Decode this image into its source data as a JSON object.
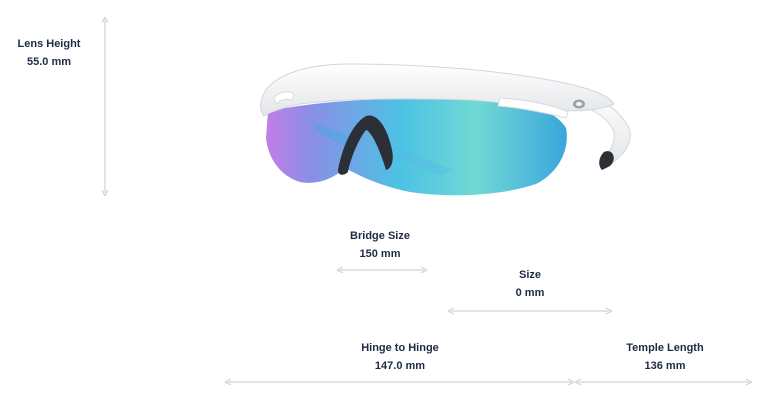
{
  "measurements": {
    "lens_height": {
      "label": "Lens Height",
      "value": "55.0 mm"
    },
    "bridge_size": {
      "label": "Bridge Size",
      "value": "150 mm"
    },
    "size": {
      "label": "Size",
      "value": "0 mm"
    },
    "hinge_to_hinge": {
      "label": "Hinge to Hinge",
      "value": "147.0 mm"
    },
    "temple_length": {
      "label": "Temple Length",
      "value": "136 mm"
    }
  },
  "colors": {
    "text": "#1f2a44",
    "dimension_line": "#c7c9cc",
    "frame": "#f1f2f4",
    "lens_blue": "#3fb2e0",
    "lens_teal": "#6fd6cf",
    "lens_purple": "#b07ce8",
    "nose_pad": "#2b2f36"
  }
}
